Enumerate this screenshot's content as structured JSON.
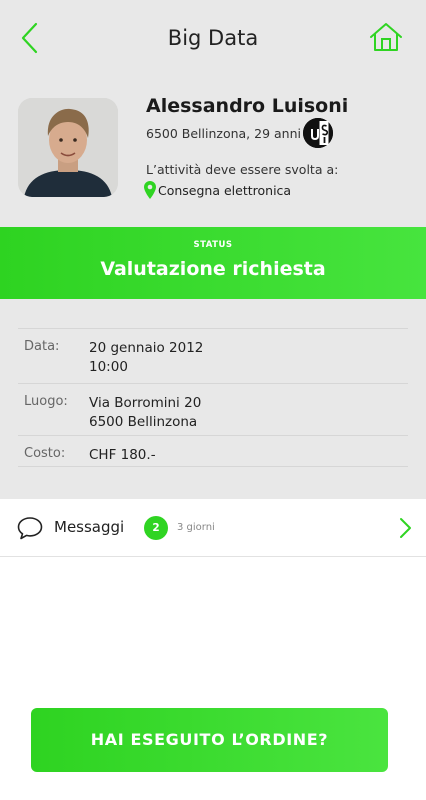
{
  "header": {
    "title": "Big Data",
    "back_icon": "chevron-left-icon",
    "home_icon": "home-icon"
  },
  "profile": {
    "name": "Alessandro Luisoni",
    "location": "6500 Bellinzona, 29 anni",
    "logo_text": "usi",
    "activity_label": "L’attività deve essere svolta a:",
    "delivery": "Consegna elettronica"
  },
  "status": {
    "label": "STATUS",
    "value": "Valutazione richiesta"
  },
  "details": {
    "date_label": "Data:",
    "date_line1": "20 gennaio 2012",
    "date_line2": "10:00",
    "place_label": "Luogo:",
    "place_line1": "Via Borromini 20",
    "place_line2": "6500 Bellinzona",
    "cost_label": "Costo:",
    "cost_value": "CHF 180.-"
  },
  "messages": {
    "label": "Messaggi",
    "count": "2",
    "time": "3 giorni"
  },
  "cta": {
    "label": "HAI ESEGUITO L’ORDINE?"
  },
  "colors": {
    "accent": "#2fd422",
    "panel_bg": "#e8e8e8",
    "text": "#222222"
  }
}
